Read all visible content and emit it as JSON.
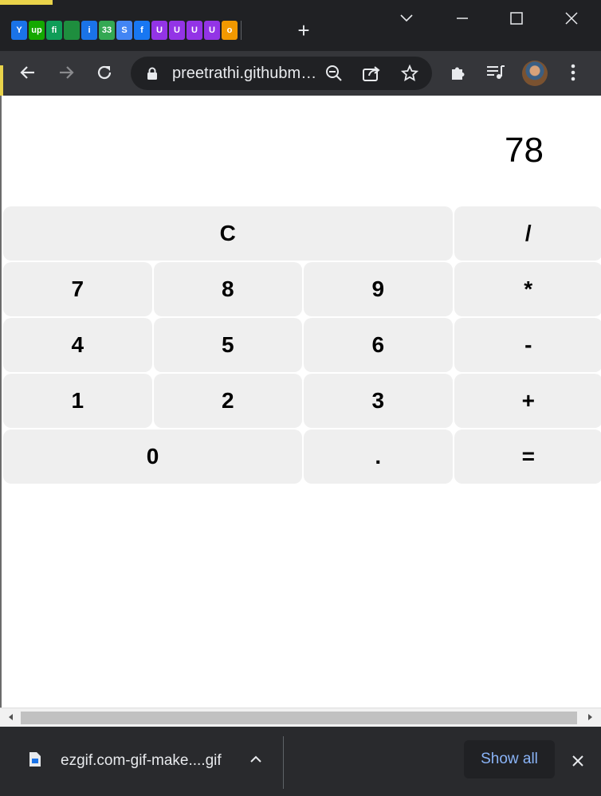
{
  "browser": {
    "url": "preetrathi.githubm…",
    "tabs": [
      {
        "icon": "y-favicon-icon",
        "color": "#1a73e8",
        "glyph": "Y"
      },
      {
        "icon": "upwork-favicon-icon",
        "color": "#14a800",
        "glyph": "up"
      },
      {
        "icon": "fi-favicon-icon",
        "color": "#0f9d58",
        "glyph": "fi"
      },
      {
        "icon": "green-square-favicon-icon",
        "color": "#1e8e3e",
        "glyph": ""
      },
      {
        "icon": "info-favicon-icon",
        "color": "#1a73e8",
        "glyph": "i"
      },
      {
        "icon": "33-favicon-icon",
        "color": "#34a853",
        "glyph": "33"
      },
      {
        "icon": "sync-favicon-icon",
        "color": "#4285f4",
        "glyph": "S"
      },
      {
        "icon": "facebook-favicon-icon",
        "color": "#1877f2",
        "glyph": "f"
      },
      {
        "icon": "u-favicon-icon",
        "color": "#9334e6",
        "glyph": "U"
      },
      {
        "icon": "u-favicon-icon",
        "color": "#9334e6",
        "glyph": "U"
      },
      {
        "icon": "u-favicon-icon",
        "color": "#9334e6",
        "glyph": "U"
      },
      {
        "icon": "u-favicon-icon",
        "color": "#9334e6",
        "glyph": "U"
      },
      {
        "icon": "orange-favicon-icon",
        "color": "#f29900",
        "glyph": "o"
      }
    ]
  },
  "calculator": {
    "display": "78",
    "keys": {
      "clear": "C",
      "divide": "/",
      "seven": "7",
      "eight": "8",
      "nine": "9",
      "multiply": "*",
      "four": "4",
      "five": "5",
      "six": "6",
      "minus": "-",
      "one": "1",
      "two": "2",
      "three": "3",
      "plus": "+",
      "zero": "0",
      "dot": ".",
      "equals": "="
    }
  },
  "downloads": {
    "file_name": "ezgif.com-gif-make....gif",
    "show_all_label": "Show all"
  },
  "colors": {
    "chrome_dark": "#202124",
    "toolbar": "#35363a",
    "key_bg": "#efefef",
    "link_blue": "#8ab4f8"
  }
}
